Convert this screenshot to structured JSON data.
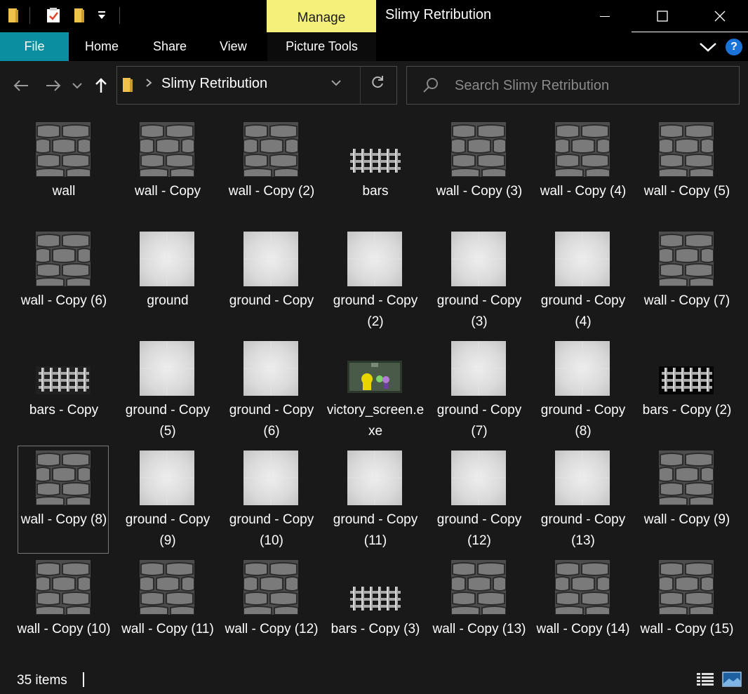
{
  "window": {
    "title": "Slimy Retribution",
    "contextual_tab": "Manage"
  },
  "ribbon": {
    "tabs": [
      "File",
      "Home",
      "Share",
      "View",
      "Picture Tools"
    ],
    "help": "?"
  },
  "address_bar": {
    "breadcrumb": "Slimy Retribution",
    "search_placeholder": "Search Slimy Retribution"
  },
  "files": [
    {
      "name": "wall",
      "type": "wall"
    },
    {
      "name": "wall - Copy",
      "type": "wall"
    },
    {
      "name": "wall - Copy (2)",
      "type": "wall"
    },
    {
      "name": "bars",
      "type": "bars"
    },
    {
      "name": "wall - Copy (3)",
      "type": "wall"
    },
    {
      "name": "wall - Copy (4)",
      "type": "wall"
    },
    {
      "name": "wall - Copy (5)",
      "type": "wall"
    },
    {
      "name": "wall - Copy (6)",
      "type": "wall"
    },
    {
      "name": "ground",
      "type": "ground"
    },
    {
      "name": "ground - Copy",
      "type": "ground"
    },
    {
      "name": "ground - Copy (2)",
      "type": "ground"
    },
    {
      "name": "ground - Copy (3)",
      "type": "ground"
    },
    {
      "name": "ground - Copy (4)",
      "type": "ground"
    },
    {
      "name": "wall - Copy (7)",
      "type": "wall"
    },
    {
      "name": "bars - Copy",
      "type": "bars-dark"
    },
    {
      "name": "ground - Copy (5)",
      "type": "ground"
    },
    {
      "name": "ground - Copy (6)",
      "type": "ground"
    },
    {
      "name": "victory_screen.exe",
      "type": "exe"
    },
    {
      "name": "ground - Copy (7)",
      "type": "ground"
    },
    {
      "name": "ground - Copy (8)",
      "type": "ground"
    },
    {
      "name": "bars - Copy (2)",
      "type": "bars-black"
    },
    {
      "name": "wall - Copy (8)",
      "type": "wall",
      "selected": true
    },
    {
      "name": "ground - Copy (9)",
      "type": "ground"
    },
    {
      "name": "ground - Copy (10)",
      "type": "ground"
    },
    {
      "name": "ground - Copy (11)",
      "type": "ground"
    },
    {
      "name": "ground - Copy (12)",
      "type": "ground"
    },
    {
      "name": "ground - Copy (13)",
      "type": "ground"
    },
    {
      "name": "wall - Copy (9)",
      "type": "wall"
    },
    {
      "name": "wall - Copy (10)",
      "type": "wall"
    },
    {
      "name": "wall - Copy (11)",
      "type": "wall"
    },
    {
      "name": "wall - Copy (12)",
      "type": "wall"
    },
    {
      "name": "bars - Copy (3)",
      "type": "bars"
    },
    {
      "name": "wall - Copy (13)",
      "type": "wall"
    },
    {
      "name": "wall - Copy (14)",
      "type": "wall"
    },
    {
      "name": "wall - Copy (15)",
      "type": "wall"
    }
  ],
  "status": {
    "item_count": "35 items"
  },
  "colors": {
    "accent_file_tab": "#0a8ea0",
    "manage_tab": "#f5f07a",
    "background": "#191919",
    "help_icon": "#1a73d9"
  }
}
